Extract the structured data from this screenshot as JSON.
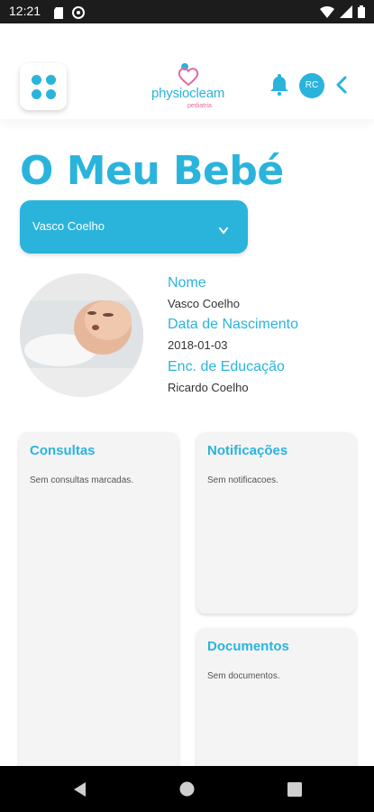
{
  "status_bar": {
    "time": "12:21",
    "icons": [
      "sd-card-icon",
      "at-icon",
      "wifi-icon",
      "signal-icon",
      "battery-icon"
    ]
  },
  "header": {
    "brand_main": "physiocleam",
    "brand_sub": "pediatria",
    "user_initials": "RC",
    "accent_color": "#2ab4dc"
  },
  "page": {
    "title": "O Meu Bebé"
  },
  "child_select": {
    "value": "Vasco Coelho"
  },
  "profile": {
    "name_label": "Nome",
    "name_value": "Vasco Coelho",
    "birth_label": "Data de Nascimento",
    "birth_value": "2018-01-03",
    "guardian_label": "Enc. de Educação",
    "guardian_value": "Ricardo Coelho"
  },
  "cards": {
    "consultas": {
      "title": "Consultas",
      "text": "Sem consultas marcadas."
    },
    "notificacoes": {
      "title": "Notificações",
      "text": "Sem notificacoes."
    },
    "documentos": {
      "title": "Documentos",
      "text": "Sem documentos."
    }
  }
}
